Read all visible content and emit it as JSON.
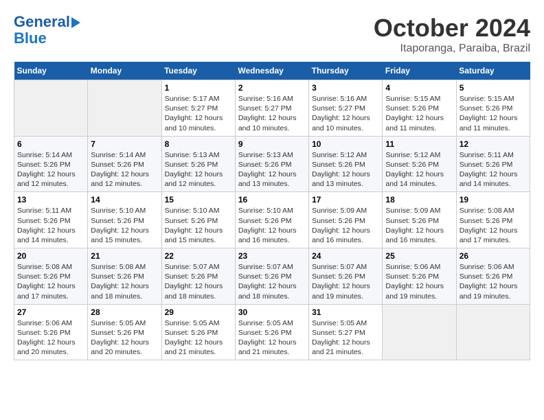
{
  "logo": {
    "line1": "General",
    "line2": "Blue"
  },
  "title": "October 2024",
  "location": "Itaporanga, Paraiba, Brazil",
  "weekdays": [
    "Sunday",
    "Monday",
    "Tuesday",
    "Wednesday",
    "Thursday",
    "Friday",
    "Saturday"
  ],
  "weeks": [
    [
      {
        "day": "",
        "empty": true
      },
      {
        "day": "",
        "empty": true
      },
      {
        "day": "1",
        "sunrise": "5:17 AM",
        "sunset": "5:27 PM",
        "daylight": "12 hours and 10 minutes."
      },
      {
        "day": "2",
        "sunrise": "5:16 AM",
        "sunset": "5:27 PM",
        "daylight": "12 hours and 10 minutes."
      },
      {
        "day": "3",
        "sunrise": "5:16 AM",
        "sunset": "5:27 PM",
        "daylight": "12 hours and 10 minutes."
      },
      {
        "day": "4",
        "sunrise": "5:15 AM",
        "sunset": "5:26 PM",
        "daylight": "12 hours and 11 minutes."
      },
      {
        "day": "5",
        "sunrise": "5:15 AM",
        "sunset": "5:26 PM",
        "daylight": "12 hours and 11 minutes."
      }
    ],
    [
      {
        "day": "6",
        "sunrise": "5:14 AM",
        "sunset": "5:26 PM",
        "daylight": "12 hours and 12 minutes."
      },
      {
        "day": "7",
        "sunrise": "5:14 AM",
        "sunset": "5:26 PM",
        "daylight": "12 hours and 12 minutes."
      },
      {
        "day": "8",
        "sunrise": "5:13 AM",
        "sunset": "5:26 PM",
        "daylight": "12 hours and 12 minutes."
      },
      {
        "day": "9",
        "sunrise": "5:13 AM",
        "sunset": "5:26 PM",
        "daylight": "12 hours and 13 minutes."
      },
      {
        "day": "10",
        "sunrise": "5:12 AM",
        "sunset": "5:26 PM",
        "daylight": "12 hours and 13 minutes."
      },
      {
        "day": "11",
        "sunrise": "5:12 AM",
        "sunset": "5:26 PM",
        "daylight": "12 hours and 14 minutes."
      },
      {
        "day": "12",
        "sunrise": "5:11 AM",
        "sunset": "5:26 PM",
        "daylight": "12 hours and 14 minutes."
      }
    ],
    [
      {
        "day": "13",
        "sunrise": "5:11 AM",
        "sunset": "5:26 PM",
        "daylight": "12 hours and 14 minutes."
      },
      {
        "day": "14",
        "sunrise": "5:10 AM",
        "sunset": "5:26 PM",
        "daylight": "12 hours and 15 minutes."
      },
      {
        "day": "15",
        "sunrise": "5:10 AM",
        "sunset": "5:26 PM",
        "daylight": "12 hours and 15 minutes."
      },
      {
        "day": "16",
        "sunrise": "5:10 AM",
        "sunset": "5:26 PM",
        "daylight": "12 hours and 16 minutes."
      },
      {
        "day": "17",
        "sunrise": "5:09 AM",
        "sunset": "5:26 PM",
        "daylight": "12 hours and 16 minutes."
      },
      {
        "day": "18",
        "sunrise": "5:09 AM",
        "sunset": "5:26 PM",
        "daylight": "12 hours and 16 minutes."
      },
      {
        "day": "19",
        "sunrise": "5:08 AM",
        "sunset": "5:26 PM",
        "daylight": "12 hours and 17 minutes."
      }
    ],
    [
      {
        "day": "20",
        "sunrise": "5:08 AM",
        "sunset": "5:26 PM",
        "daylight": "12 hours and 17 minutes."
      },
      {
        "day": "21",
        "sunrise": "5:08 AM",
        "sunset": "5:26 PM",
        "daylight": "12 hours and 18 minutes."
      },
      {
        "day": "22",
        "sunrise": "5:07 AM",
        "sunset": "5:26 PM",
        "daylight": "12 hours and 18 minutes."
      },
      {
        "day": "23",
        "sunrise": "5:07 AM",
        "sunset": "5:26 PM",
        "daylight": "12 hours and 18 minutes."
      },
      {
        "day": "24",
        "sunrise": "5:07 AM",
        "sunset": "5:26 PM",
        "daylight": "12 hours and 19 minutes."
      },
      {
        "day": "25",
        "sunrise": "5:06 AM",
        "sunset": "5:26 PM",
        "daylight": "12 hours and 19 minutes."
      },
      {
        "day": "26",
        "sunrise": "5:06 AM",
        "sunset": "5:26 PM",
        "daylight": "12 hours and 19 minutes."
      }
    ],
    [
      {
        "day": "27",
        "sunrise": "5:06 AM",
        "sunset": "5:26 PM",
        "daylight": "12 hours and 20 minutes."
      },
      {
        "day": "28",
        "sunrise": "5:05 AM",
        "sunset": "5:26 PM",
        "daylight": "12 hours and 20 minutes."
      },
      {
        "day": "29",
        "sunrise": "5:05 AM",
        "sunset": "5:26 PM",
        "daylight": "12 hours and 21 minutes."
      },
      {
        "day": "30",
        "sunrise": "5:05 AM",
        "sunset": "5:26 PM",
        "daylight": "12 hours and 21 minutes."
      },
      {
        "day": "31",
        "sunrise": "5:05 AM",
        "sunset": "5:27 PM",
        "daylight": "12 hours and 21 minutes."
      },
      {
        "day": "",
        "empty": true
      },
      {
        "day": "",
        "empty": true
      }
    ]
  ],
  "labels": {
    "sunrise": "Sunrise:",
    "sunset": "Sunset:",
    "daylight": "Daylight:"
  }
}
